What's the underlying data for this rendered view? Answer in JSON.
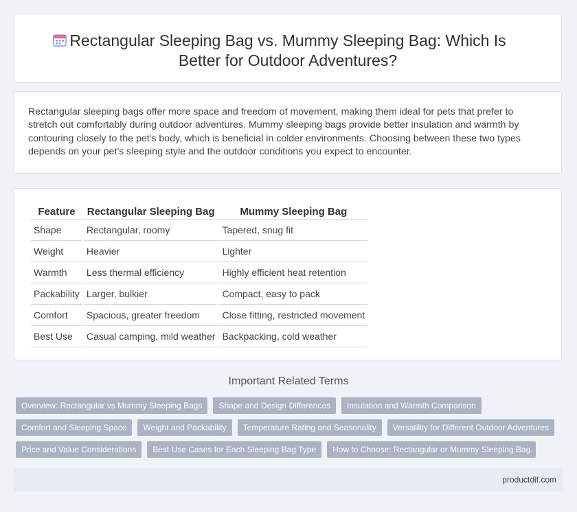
{
  "header": {
    "icon": "calendar-icon",
    "title": "Rectangular Sleeping Bag vs. Mummy Sleeping Bag: Which Is Better for Outdoor Adventures?"
  },
  "intro": {
    "text": "Rectangular sleeping bags offer more space and freedom of movement, making them ideal for pets that prefer to stretch out comfortably during outdoor adventures. Mummy sleeping bags provide better insulation and warmth by contouring closely to the pet's body, which is beneficial in colder environments. Choosing between these two types depends on your pet's sleeping style and the outdoor conditions you expect to encounter."
  },
  "table": {
    "headers": [
      "Feature",
      "Rectangular Sleeping Bag",
      "Mummy Sleeping Bag"
    ],
    "rows": [
      [
        "Shape",
        "Rectangular, roomy",
        "Tapered, snug fit"
      ],
      [
        "Weight",
        "Heavier",
        "Lighter"
      ],
      [
        "Warmth",
        "Less thermal efficiency",
        "Highly efficient heat retention"
      ],
      [
        "Packability",
        "Larger, bulkier",
        "Compact, easy to pack"
      ],
      [
        "Comfort",
        "Spacious, greater freedom",
        "Close fitting, restricted movement"
      ],
      [
        "Best Use",
        "Casual camping, mild weather",
        "Backpacking, cold weather"
      ]
    ]
  },
  "related": {
    "title": "Important Related Terms",
    "tags": [
      "Overview: Rectangular vs Mummy Sleeping Bags",
      "Shape and Design Differences",
      "Insulation and Warmth Comparison",
      "Comfort and Sleeping Space",
      "Weight and Packability",
      "Temperature Rating and Seasonality",
      "Versatility for Different Outdoor Adventures",
      "Price and Value Considerations",
      "Best Use Cases for Each Sleeping Bag Type",
      "How to Choose: Rectangular or Mummy Sleeping Bag"
    ]
  },
  "footer": {
    "site": "productdif.com"
  },
  "colors": {
    "background": "#f0f2f7",
    "tag": "#aab3c3",
    "footer": "#e6ebf4"
  }
}
